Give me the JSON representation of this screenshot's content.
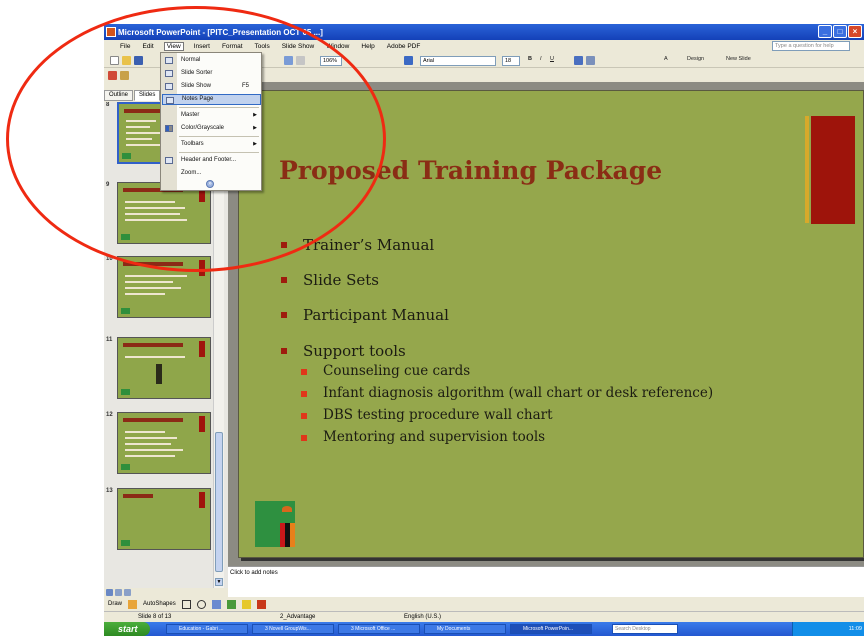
{
  "window": {
    "title": "Microsoft PowerPoint - [PITC_Presentation OCT 05 ...]"
  },
  "menubar": {
    "items": [
      "File",
      "Edit",
      "View",
      "Insert",
      "Format",
      "Tools",
      "Slide Show",
      "Window",
      "Help",
      "Adobe PDF"
    ],
    "help_placeholder": "Type a question for help"
  },
  "toolbar": {
    "zoom": "106%",
    "font": "Arial",
    "font_size": "18",
    "design_label": "Design",
    "new_slide_label": "New Slide"
  },
  "panel": {
    "tabs": [
      "Outline",
      "Slides"
    ]
  },
  "view_menu": {
    "items": [
      {
        "label": "Normal",
        "shortcut": "",
        "submenu": false
      },
      {
        "label": "Slide Sorter",
        "shortcut": "",
        "submenu": false
      },
      {
        "label": "Slide Show",
        "shortcut": "F5",
        "submenu": false
      },
      {
        "label": "Notes Page",
        "shortcut": "",
        "submenu": false
      },
      {
        "label": "Master",
        "shortcut": "",
        "submenu": true
      },
      {
        "label": "Color/Grayscale",
        "shortcut": "",
        "submenu": true
      },
      {
        "label": "Toolbars",
        "shortcut": "",
        "submenu": true
      },
      {
        "label": "Header and Footer...",
        "shortcut": "",
        "submenu": false
      },
      {
        "label": "Zoom...",
        "shortcut": "",
        "submenu": false
      }
    ],
    "highlighted": "Notes Page"
  },
  "thumbnails": [
    {
      "number": "8"
    },
    {
      "number": "9"
    },
    {
      "number": "10"
    },
    {
      "number": "11"
    },
    {
      "number": "12"
    },
    {
      "number": "13"
    }
  ],
  "slide": {
    "title": "Proposed Training Package",
    "bullets": [
      "Trainer’s Manual",
      "Slide Sets",
      "Participant Manual",
      "Support tools"
    ],
    "sub_bullets": [
      "Counseling cue cards",
      "Infant diagnosis algorithm (wall chart or desk reference)",
      "DBS testing procedure wall chart",
      "Mentoring and supervision tools"
    ],
    "colors": {
      "background": "#95a74c",
      "title": "#8a2d15",
      "accent_red": "#9e140b",
      "accent_gold": "#d8a92a"
    }
  },
  "notes": {
    "placeholder": "Click to add notes"
  },
  "draw_toolbar": {
    "draw_label": "Draw",
    "autoshapes_label": "AutoShapes"
  },
  "status": {
    "slide": "Slide 8 of 13",
    "design": "2_Advantage",
    "language": "English (U.S.)"
  },
  "taskbar": {
    "start_label": "start",
    "items": [
      "Education - Gabri ...",
      "3 Novell GroupWis...",
      "3 Microsoft Office ...",
      "My Documents",
      "Microsoft PowerPoin..."
    ],
    "search_placeholder": "Search Desktop",
    "time": "11:09"
  }
}
